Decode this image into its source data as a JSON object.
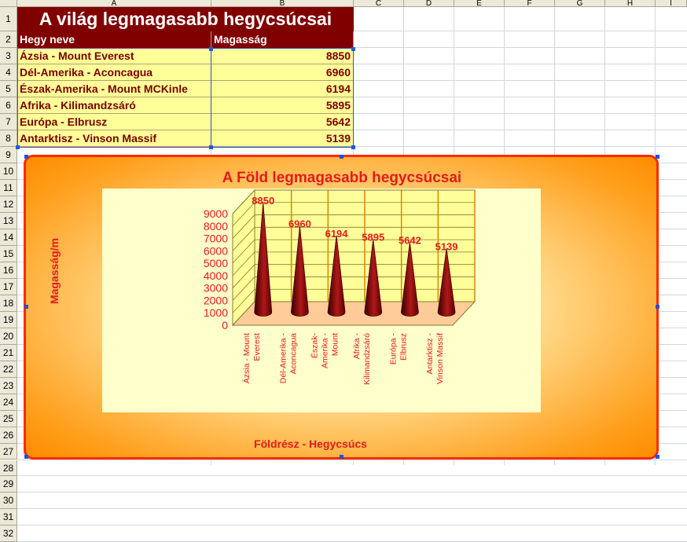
{
  "columns": [
    "A",
    "B",
    "C",
    "D",
    "E",
    "F",
    "G",
    "H",
    "I"
  ],
  "rows": [
    "1",
    "2",
    "3",
    "4",
    "5",
    "6",
    "7",
    "8",
    "9",
    "10",
    "11",
    "12",
    "13",
    "14",
    "15",
    "16",
    "17",
    "18",
    "19",
    "20",
    "21",
    "22",
    "23",
    "24",
    "25",
    "26",
    "27",
    "28",
    "29",
    "30",
    "31",
    "32"
  ],
  "sheet": {
    "title": "A világ legmagasabb hegycsúcsai",
    "header": [
      "Hegy neve",
      "Magasság"
    ],
    "data": [
      [
        "Ázsia - Mount Everest",
        "8850"
      ],
      [
        "Dél-Amerika - Aconcagua",
        "6960"
      ],
      [
        "Észak-Amerika - Mount MCKinle",
        "6194"
      ],
      [
        "Afrika - Kilimandzsáró",
        "5895"
      ],
      [
        "Európa - Elbrusz",
        "5642"
      ],
      [
        "Antarktisz - Vinson Massif",
        "5139"
      ]
    ]
  },
  "colors": {
    "header_bg": "#800000",
    "data_bg": "#ffff99",
    "chart_text": "#e31b1b",
    "cone": "#7a0000"
  },
  "chart_data": {
    "type": "bar",
    "shape": "3d-cone",
    "title": "A Föld legmagasabb hegycsúcsai",
    "xlabel": "Földrész - Hegycsúcs",
    "ylabel": "Magasság/m",
    "categories": [
      [
        "Ázsia - Mount",
        "Everest"
      ],
      [
        "Dél-Amerika -",
        "Aconcagua"
      ],
      [
        "Észak-",
        "Amerika -",
        "Mount"
      ],
      [
        "Afrika -",
        "Kilimandzsáró"
      ],
      [
        "Európa -",
        "Elbrusz"
      ],
      [
        "Antarktisz -",
        "Vinson Massif"
      ]
    ],
    "values": [
      8850,
      6960,
      6194,
      5895,
      5642,
      5139
    ],
    "yticks": [
      "0",
      "1000",
      "2000",
      "3000",
      "4000",
      "5000",
      "6000",
      "7000",
      "8000",
      "9000"
    ],
    "ylim": [
      0,
      9000
    ],
    "legend": "none",
    "grid": true
  }
}
